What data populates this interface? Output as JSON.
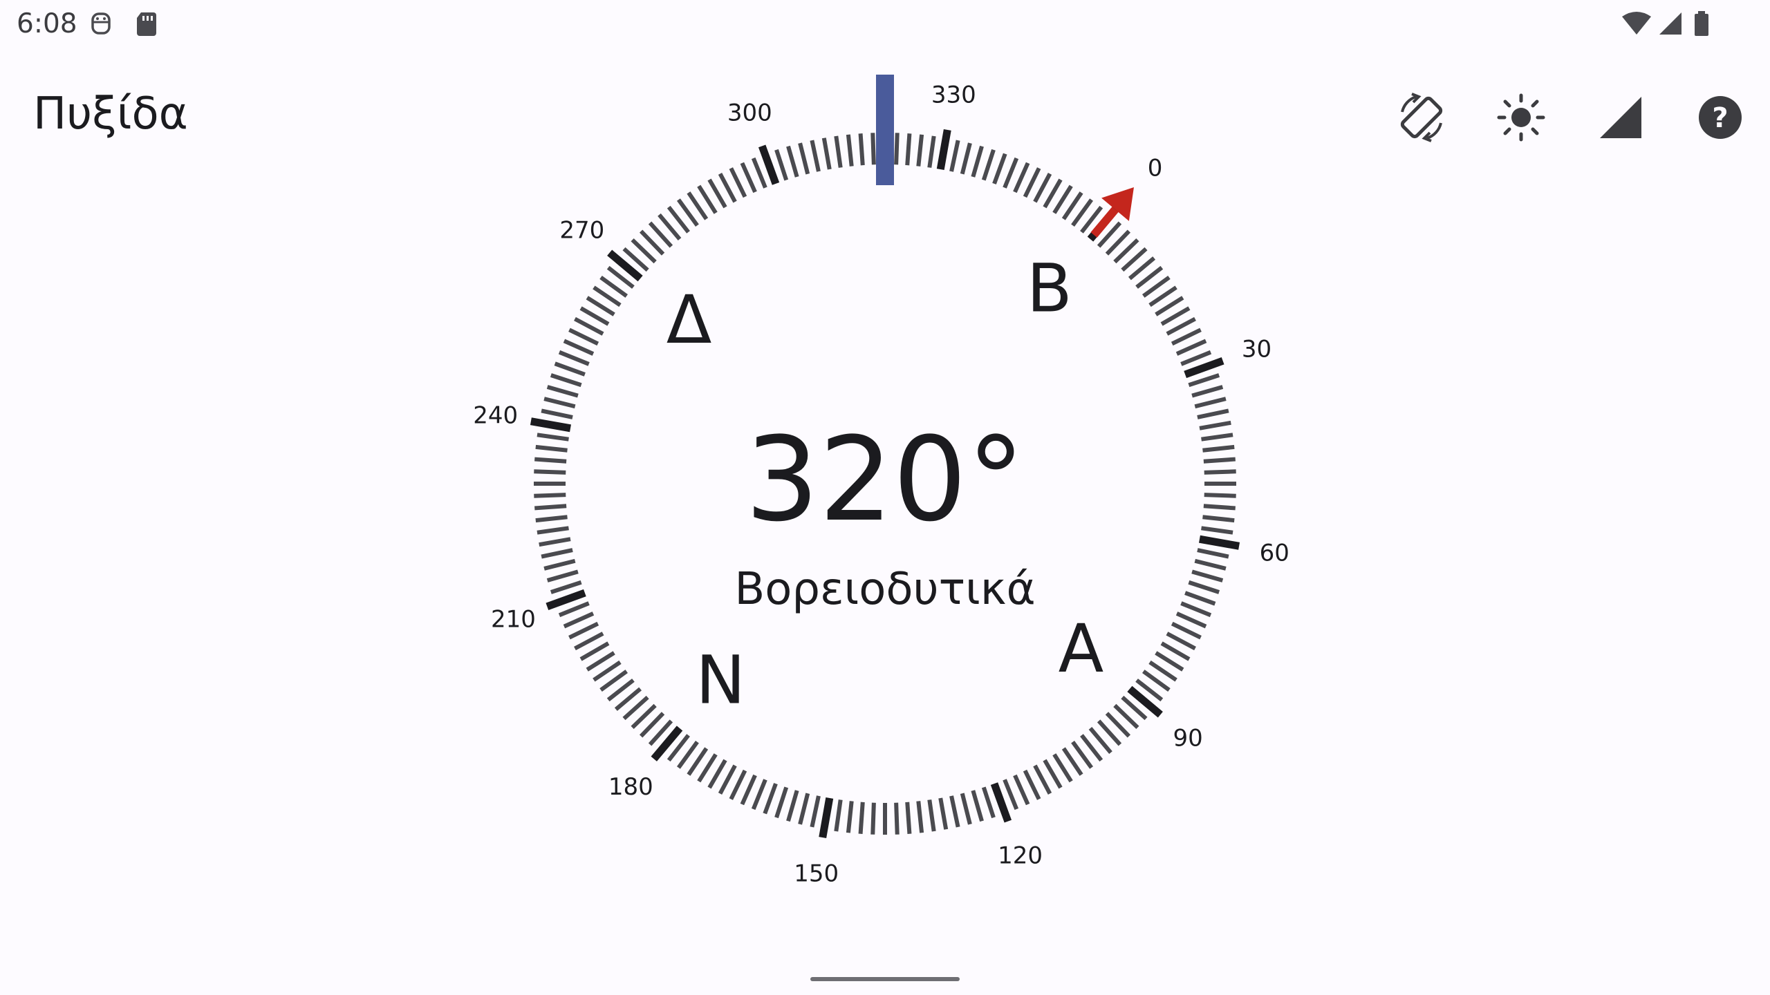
{
  "status_bar": {
    "time": "6:08",
    "left_icons": [
      "notification-face-icon",
      "sd-card-icon"
    ],
    "right_icons": [
      "wifi-icon",
      "cellular-signal-icon",
      "battery-icon"
    ]
  },
  "app_bar": {
    "title": "Πυξίδα",
    "actions": [
      "rotate-screen-icon",
      "brightness-icon",
      "signal-icon",
      "help-icon"
    ]
  },
  "compass": {
    "heading_value": "320°",
    "heading_direction": "Βορειοδυτικά",
    "heading_degrees": 320,
    "north_indicator_label": "0",
    "cardinal_labels": {
      "north": "B",
      "east": "A",
      "south": "N",
      "west": "Δ"
    },
    "degree_labels": [
      "0",
      "30",
      "60",
      "90",
      "120",
      "150",
      "180",
      "210",
      "240",
      "270",
      "300",
      "330"
    ],
    "colors": {
      "heading_marker": "#4a5b9b",
      "north_arrow": "#c4261d",
      "major_tick": "#1b1b1f",
      "minor_tick": "#4a4a4f"
    }
  }
}
